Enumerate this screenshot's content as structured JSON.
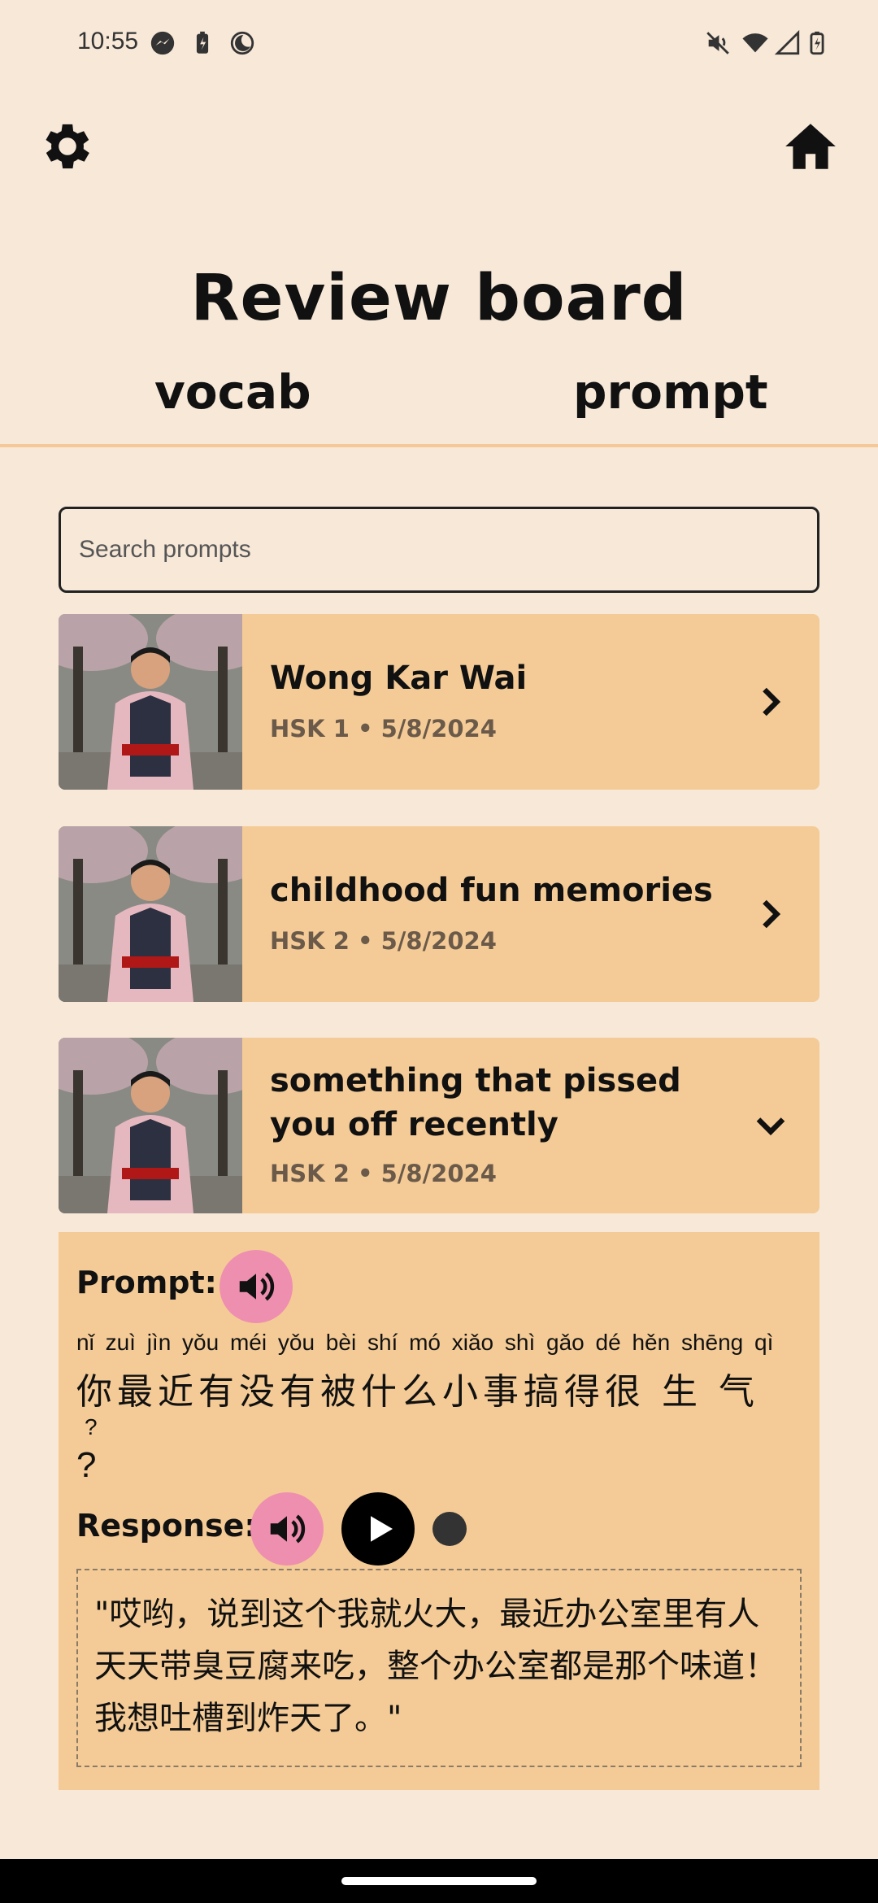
{
  "status": {
    "time": "10:55"
  },
  "header": {
    "title": "Review board",
    "tabs": [
      "vocab",
      "prompt"
    ]
  },
  "search": {
    "placeholder": "Search prompts"
  },
  "prompts": [
    {
      "title": "Wong Kar Wai",
      "meta": "HSK 1 • 5/8/2024",
      "expanded": false
    },
    {
      "title": "childhood fun memories",
      "meta": "HSK 2 • 5/8/2024",
      "expanded": false
    },
    {
      "title": "something that pissed you off recently",
      "title_line1": "something that pissed you",
      "title_line2": "off recently",
      "meta": "HSK 2 • 5/8/2024",
      "expanded": true
    }
  ],
  "detail": {
    "prompt_label": "Prompt:",
    "pinyin": "nǐ zuì jìn yǒu méi yǒu bèi shí mó xiǎo shì gǎo dé hěn shēng qì",
    "hanzi": "你最近有没有被什么小事搞得很 生 气",
    "question_small": "?",
    "question_large": "?",
    "response_label": "Response:",
    "response_text": "\"哎哟，说到这个我就火大，最近办公室里有人天天带臭豆腐来吃，整个办公室都是那个味道！我想吐槽到炸天了。\""
  },
  "colors": {
    "background": "#F7E8D8",
    "card": "#F4CB96",
    "accent_pink": "#EE8FB0",
    "divider": "#F5C897"
  }
}
